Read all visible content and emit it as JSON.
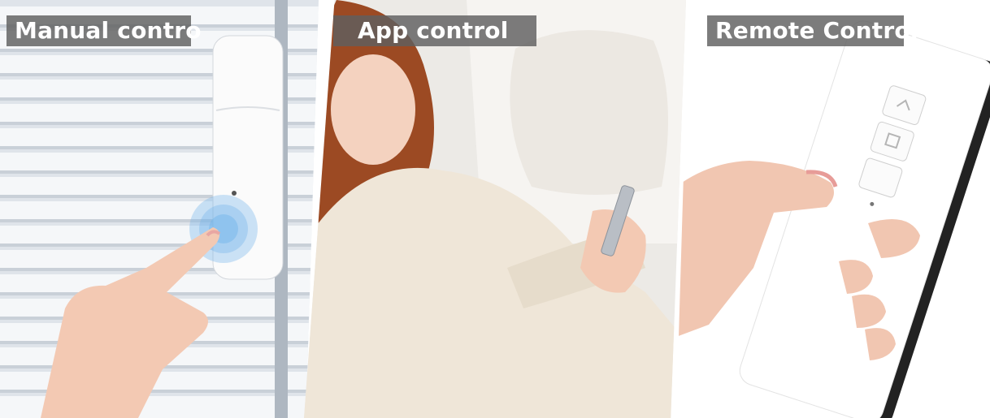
{
  "panels": [
    {
      "label": "Manual contro"
    },
    {
      "label": "App control"
    },
    {
      "label": "Remote Control"
    }
  ],
  "colors": {
    "label_background": "#5f5f5f",
    "label_text": "#ffffff",
    "blind_slat": "#f4f6f8",
    "sweater": "#efe6d8",
    "hair": "#9c4a23",
    "remote_body": "#ffffff",
    "remote_edge": "#222222",
    "touch_glow": "#6fb3ea"
  },
  "icons": [
    "up-arrow-icon",
    "stop-square-icon",
    "down-arrow-icon",
    "touch-ripple-icon"
  ]
}
